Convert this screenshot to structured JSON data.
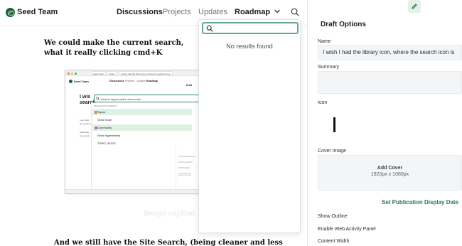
{
  "header": {
    "site_name": "Seed Team",
    "nav": [
      {
        "label": "Discussions"
      },
      {
        "label": "Projects"
      },
      {
        "label": "Updates"
      },
      {
        "label": "Roadmap"
      }
    ],
    "more_icon": "chevron-down-icon",
    "search_icon": "search-icon"
  },
  "content": {
    "paragraph_1": "We could make the current search, what it really clicking cmd+K",
    "image_caption": "Image caption",
    "paragraph_2": "And we still have the Site Search, (being cleaner and less"
  },
  "embedded_screenshot": {
    "tabs": [
      "Seed Team",
      "Topics",
      "I wish I had the library icon, where the search icon is"
    ],
    "site_name": "Seed Team",
    "nav": [
      "Discussions",
      "Projects",
      "Updates",
      "Roadmap"
    ],
    "heading": "I wis search",
    "search_placeholder": "Search Hypermedia documents",
    "section_label": "RECENT DOCUMENTS",
    "results": [
      {
        "label": "Topics",
        "highlighted": true
      },
      {
        "label": "Seed Team",
        "highlighted": false
      },
      {
        "label": "Community",
        "highlighted": true
      },
      {
        "label": "Seed Hypermedia",
        "highlighted": false
      },
      {
        "label": "TOPIC: BUGS",
        "highlighted": false
      }
    ],
    "panel_title": "Draft",
    "body_lines": [
      "I am clicki",
      "up a search",
      "Obviously",
      "up everyw"
    ]
  },
  "search_popover": {
    "input_value": "",
    "empty_text": "No results found"
  },
  "draft_options": {
    "title": "Draft Options",
    "edit_icon": "pencil-icon",
    "name_label": "Name",
    "name_value": "I wish I had the library icon, where the search icon is",
    "summary_label": "Summary",
    "summary_value": "",
    "icon_label": "Icon",
    "cover_label": "Cover Image",
    "add_cover": "Add Cover",
    "cover_size": "1920px x 1080px",
    "publication_link": "Set Publication Display Date",
    "show_outline": "Show Outline",
    "web_activity": "Enable Web Activity Panel",
    "content_width": "Content Width"
  },
  "colors": {
    "accent": "#2c7a55",
    "focus_ring": "#63a596",
    "highlight_row": "#def1e3"
  }
}
